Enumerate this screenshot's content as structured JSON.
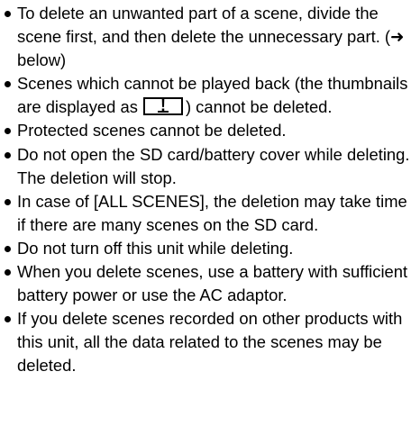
{
  "notes": [
    {
      "text": "To delete an unwanted part of a scene, divide the scene first, and then delete the unnecessary part. (➜ below)"
    },
    {
      "text_before": "Scenes which cannot be played back (the thumbnails are displayed as",
      "icon_symbol": "!",
      "text_after": ") cannot be deleted."
    },
    {
      "text": "Protected scenes cannot be deleted."
    },
    {
      "text": "Do not open the SD card/battery cover while deleting. The deletion will stop."
    },
    {
      "text": "In case of [ALL SCENES], the deletion may take time if there are many scenes on the SD card."
    },
    {
      "text": "Do not turn off this unit while deleting."
    },
    {
      "text": "When you delete scenes, use a battery with sufficient battery power or use the AC adaptor."
    },
    {
      "text": "If you delete scenes recorded on other products with this unit, all the data related to the scenes may be deleted."
    }
  ]
}
